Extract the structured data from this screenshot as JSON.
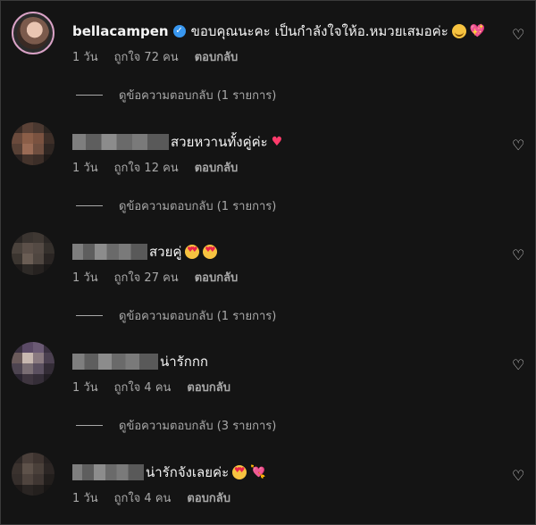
{
  "colors": {
    "background": "#141414",
    "text": "#f5f5f5",
    "secondary": "#a8a8a8",
    "verified": "#3897f0"
  },
  "comments": [
    {
      "username": "bellacampen",
      "verified": true,
      "text": "ขอบคุณนะคะ เป็นกำลังใจให้อ.หมวยเสมอค่ะ",
      "emojis": [
        "smiling-face",
        "sparkling-heart"
      ],
      "time": "1 วัน",
      "likes": "ถูกใจ 72 คน",
      "reply": "ตอบกลับ",
      "view_replies": "ดูข้อความตอบกลับ (1 รายการ)"
    },
    {
      "username": "",
      "text": "สวยหวานทั้งคู่ค่ะ",
      "emojis": [
        "heart"
      ],
      "time": "1 วัน",
      "likes": "ถูกใจ 12 คน",
      "reply": "ตอบกลับ",
      "view_replies": "ดูข้อความตอบกลับ (1 รายการ)"
    },
    {
      "username": "",
      "text": "สวยคู่",
      "emojis": [
        "heart-eyes",
        "heart-eyes"
      ],
      "time": "1 วัน",
      "likes": "ถูกใจ 27 คน",
      "reply": "ตอบกลับ",
      "view_replies": "ดูข้อความตอบกลับ (1 รายการ)"
    },
    {
      "username": "",
      "text": "น่ารักกก",
      "emojis": [],
      "time": "1 วัน",
      "likes": "ถูกใจ 4 คน",
      "reply": "ตอบกลับ",
      "view_replies": "ดูข้อความตอบกลับ (3 รายการ)"
    },
    {
      "username": "",
      "text": "น่ารักจังเลยค่ะ",
      "emojis": [
        "heart-eyes",
        "heart-with-arrow"
      ],
      "time": "1 วัน",
      "likes": "ถูกใจ 4 คน",
      "reply": "ตอบกลับ"
    }
  ]
}
